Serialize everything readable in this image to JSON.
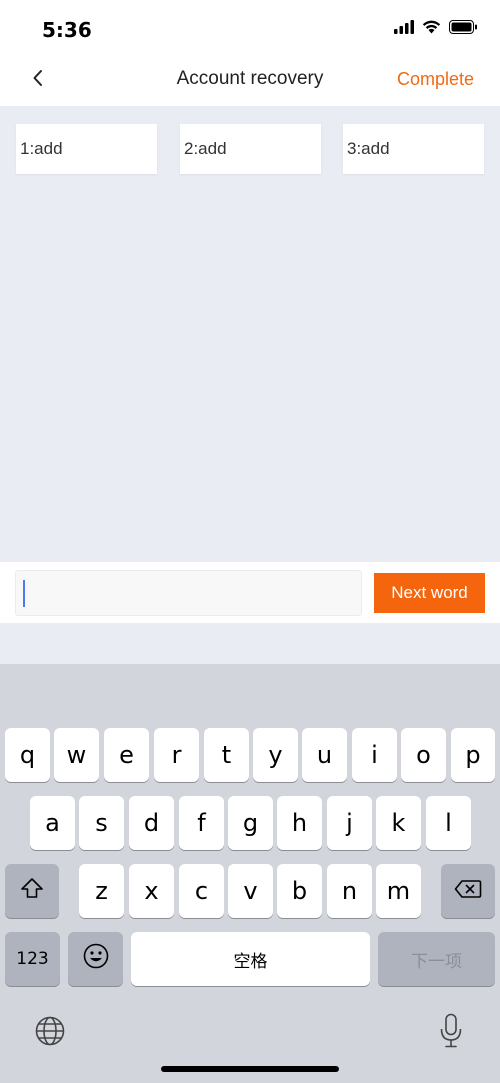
{
  "status_bar": {
    "time": "5:36"
  },
  "nav": {
    "title": "Account recovery",
    "complete_label": "Complete"
  },
  "word_slots": [
    {
      "label": "1:add"
    },
    {
      "label": "2:add"
    },
    {
      "label": "3:add"
    }
  ],
  "input": {
    "value": "",
    "next_label": "Next word"
  },
  "keyboard": {
    "row1": [
      "q",
      "w",
      "e",
      "r",
      "t",
      "y",
      "u",
      "i",
      "o",
      "p"
    ],
    "row2": [
      "a",
      "s",
      "d",
      "f",
      "g",
      "h",
      "j",
      "k",
      "l"
    ],
    "row3": [
      "z",
      "x",
      "c",
      "v",
      "b",
      "n",
      "m"
    ],
    "numbers_label": "123",
    "space_label": "空格",
    "next_item_label": "下一项"
  },
  "colors": {
    "accent": "#f5650d",
    "background": "#e9ecf3"
  },
  "icons": [
    "chevron-left-icon",
    "signal-icon",
    "wifi-icon",
    "battery-icon",
    "shift-icon",
    "backspace-icon",
    "emoji-icon",
    "globe-icon",
    "microphone-icon"
  ]
}
